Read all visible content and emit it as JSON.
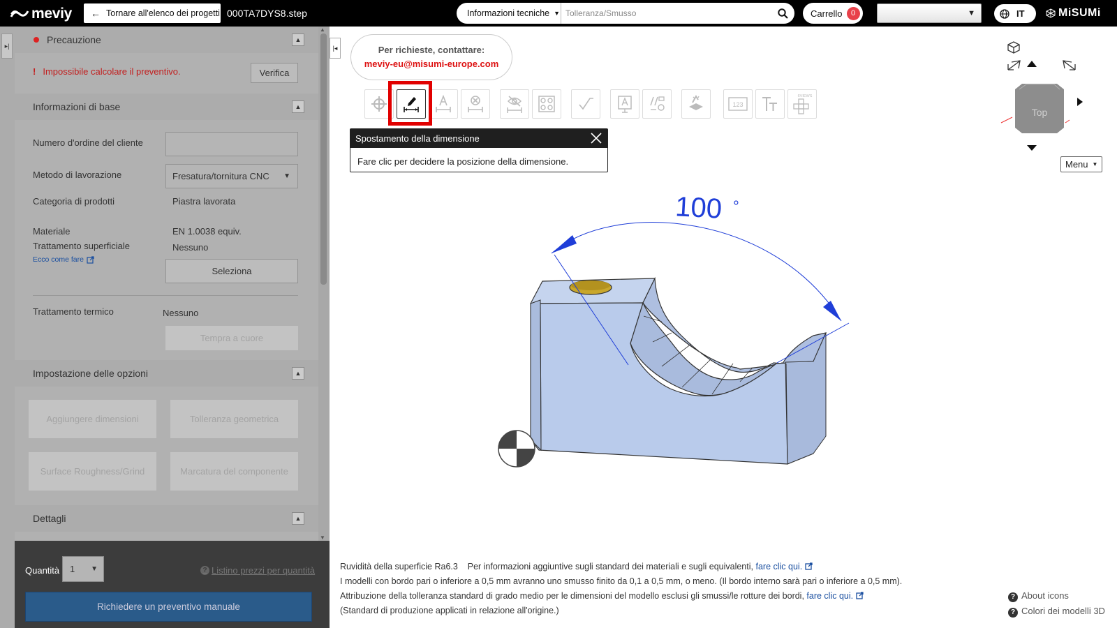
{
  "header": {
    "logo_text": "meviy",
    "back_label": "Tornare all'elenco dei progetti",
    "filename": "000TA7DYS8.step",
    "search_category": "Informazioni tecniche",
    "search_placeholder": "Tolleranza/Smusso",
    "cart_label": "Carrello",
    "cart_count": "0",
    "language_code": "IT",
    "brand": "MiSUMi"
  },
  "caution": {
    "title": "Precauzione",
    "message": "Impossibile calcolare il preventivo.",
    "verify_label": "Verifica"
  },
  "basic_info": {
    "title": "Informazioni di base",
    "order_number_label": "Numero d'ordine del cliente",
    "order_number_value": "",
    "method_label": "Metodo di lavorazione",
    "method_value": "Fresatura/tornitura CNC",
    "category_label": "Categoria di prodotti",
    "category_value": "Piastra lavorata",
    "material_label": "Materiale",
    "material_value": "EN 1.0038 equiv.",
    "surface_label": "Trattamento superficiale",
    "surface_value": "Nessuno",
    "howto_link": "Ecco come fare",
    "select_label": "Seleziona",
    "heat_label": "Trattamento termico",
    "heat_value": "Nessuno",
    "hardening_label": "Tempra a cuore"
  },
  "options": {
    "title": "Impostazione delle opzioni",
    "add_dimensions": "Aggiungere dimensioni",
    "geometric_tolerance": "Tolleranza geometrica",
    "surface_roughness": "Surface Roughness/Grind",
    "part_marking": "Marcatura del componente"
  },
  "details": {
    "title": "Dettagli"
  },
  "bottom": {
    "qty_label": "Quantità",
    "qty_value": "1",
    "price_list_link": "Listino prezzi per quantità",
    "quote_button": "Richiedere un preventivo manuale"
  },
  "contact": {
    "line1": "Per richieste, contattare:",
    "email": "meviy-eu@misumi-europe.com"
  },
  "toolbar": {
    "tools": [
      "target-icon",
      "edit-dimension-icon",
      "text-dimension-icon",
      "delete-dimension-icon",
      "hide-dimension-icon",
      "hole-pattern-icon",
      "roughness-icon",
      "annotation-icon",
      "parts-list-icon",
      "tolerance-stamp-icon",
      "numbering-icon",
      "text-icon",
      "six-views-icon"
    ],
    "six_views_label": "6VIEWS"
  },
  "tooltip": {
    "title": "Spostamento della dimensione",
    "body": "Fare clic per decidere la posizione della dimensione."
  },
  "viewcube": {
    "face_label": "Top",
    "menu_label": "Menu"
  },
  "model": {
    "angle_label": "100",
    "angle_unit": "°",
    "face_color": "#b9cbeb",
    "hole_color": "#c9a72c",
    "dimension_color": "#1f3ed8"
  },
  "footnotes": {
    "line1": "Ruvidità della superficie Ra6.3    Per informazioni aggiuntive sugli standard dei materiali e sugli equivalenti,",
    "line1_link": "fare clic qui.",
    "line2": "I modelli con bordo pari o inferiore a 0,5 mm avranno uno smusso finito da 0,1 a 0,5 mm, o meno. (Il bordo interno sarà pari o inferiore a 0,5 mm).",
    "line3": "Attribuzione della tolleranza standard di grado medio per le dimensioni del modello esclusi gli smussi/le rotture dei bordi,",
    "line3_link": "fare clic qui.",
    "line4": "(Standard di produzione applicati in relazione all'origine.)"
  },
  "help": {
    "about_icons": "About icons",
    "model_colors": "Colori dei modelli 3D"
  }
}
